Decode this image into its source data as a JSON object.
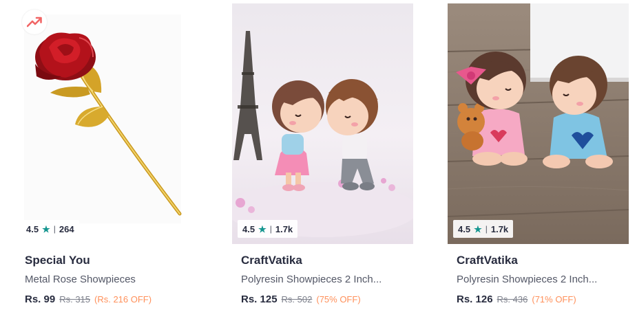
{
  "colors": {
    "star": "#14958f",
    "discount": "#ff905a",
    "trend": "#f16565"
  },
  "products": [
    {
      "brand": "Special You",
      "name": "Metal Rose Showpieces",
      "rating": "4.5",
      "rating_count": "264",
      "rating_separator": "|",
      "star_icon": "star-icon",
      "price": "Rs. 99",
      "mrp": "Rs. 315",
      "discount": "(Rs. 216 OFF)",
      "trending": true,
      "trend_icon": "trending-up-icon"
    },
    {
      "brand": "CraftVatika",
      "name": "Polyresin Showpieces 2 Inch...",
      "rating": "4.5",
      "rating_count": "1.7k",
      "rating_separator": "|",
      "star_icon": "star-icon",
      "price": "Rs. 125",
      "mrp": "Rs. 502",
      "discount": "(75% OFF)"
    },
    {
      "brand": "CraftVatika",
      "name": "Polyresin Showpieces 2 Inch...",
      "rating": "4.5",
      "rating_count": "1.7k",
      "rating_separator": "|",
      "star_icon": "star-icon",
      "price": "Rs. 126",
      "mrp": "Rs. 436",
      "discount": "(71% OFF)"
    }
  ]
}
